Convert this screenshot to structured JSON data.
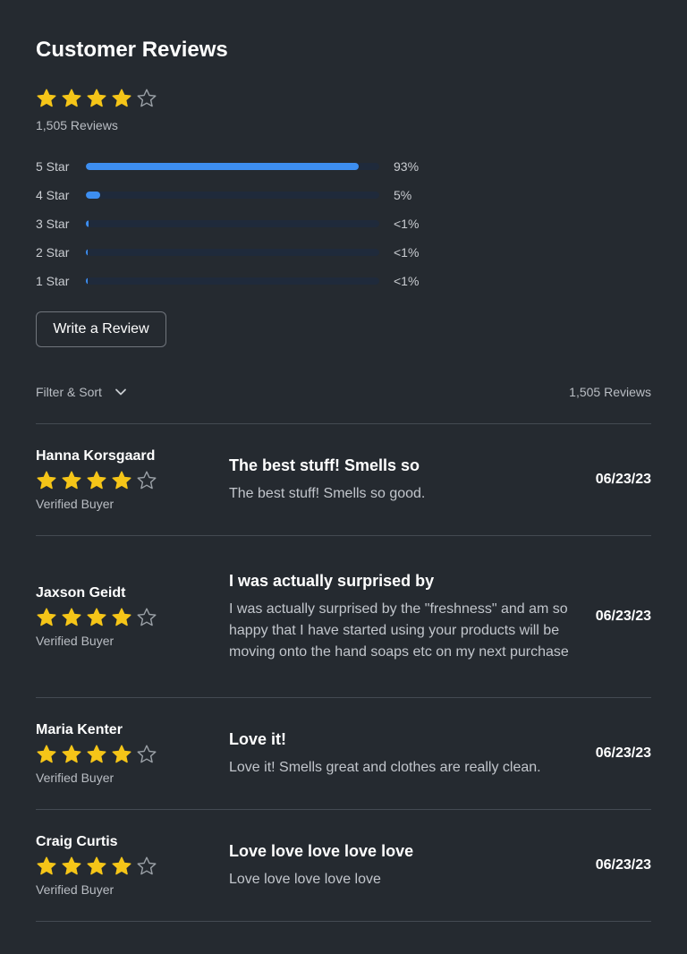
{
  "header": {
    "title": "Customer Reviews"
  },
  "summary": {
    "rating": 4,
    "max_rating": 5,
    "total_label": "1,505 Reviews",
    "distribution": [
      {
        "label": "5 Star",
        "percent_label": "93%",
        "fill_percent": 93
      },
      {
        "label": "4 Star",
        "percent_label": "5%",
        "fill_percent": 5
      },
      {
        "label": "3 Star",
        "percent_label": "<1%",
        "fill_percent": 1
      },
      {
        "label": "2 Star",
        "percent_label": "<1%",
        "fill_percent": 0
      },
      {
        "label": "1 Star",
        "percent_label": "<1%",
        "fill_percent": 0
      }
    ]
  },
  "actions": {
    "write_review_label": "Write a Review"
  },
  "toolbar": {
    "filter_label": "Filter & Sort",
    "filter_icon": "chevron-down-icon",
    "count_label": "1,505 Reviews"
  },
  "reviews": [
    {
      "name": "Hanna Korsgaard",
      "rating": 4,
      "badge": "Verified Buyer",
      "title": "The best stuff! Smells so",
      "body": "The best stuff! Smells so good.",
      "date": "06/23/23"
    },
    {
      "name": "Jaxson Geidt",
      "rating": 4,
      "badge": "Verified Buyer",
      "title": "I was actually surprised by",
      "body": "I was actually surprised by the \"freshness\" and am so happy that I have started using your products will be moving onto the hand soaps etc on my next purchase",
      "date": "06/23/23"
    },
    {
      "name": "Maria Kenter",
      "rating": 4,
      "badge": "Verified Buyer",
      "title": "Love it!",
      "body": "Love it! Smells great and clothes are really clean.",
      "date": "06/23/23"
    },
    {
      "name": "Craig Curtis",
      "rating": 4,
      "badge": "Verified Buyer",
      "title": "Love love love love love",
      "body": "Love love love love love",
      "date": "06/23/23"
    }
  ],
  "colors": {
    "background": "#252a30",
    "star_filled": "#f5c518",
    "star_empty": "#9aa0a6",
    "bar_fill": "#3d8ef0",
    "bar_track": "#1f2a3b"
  }
}
